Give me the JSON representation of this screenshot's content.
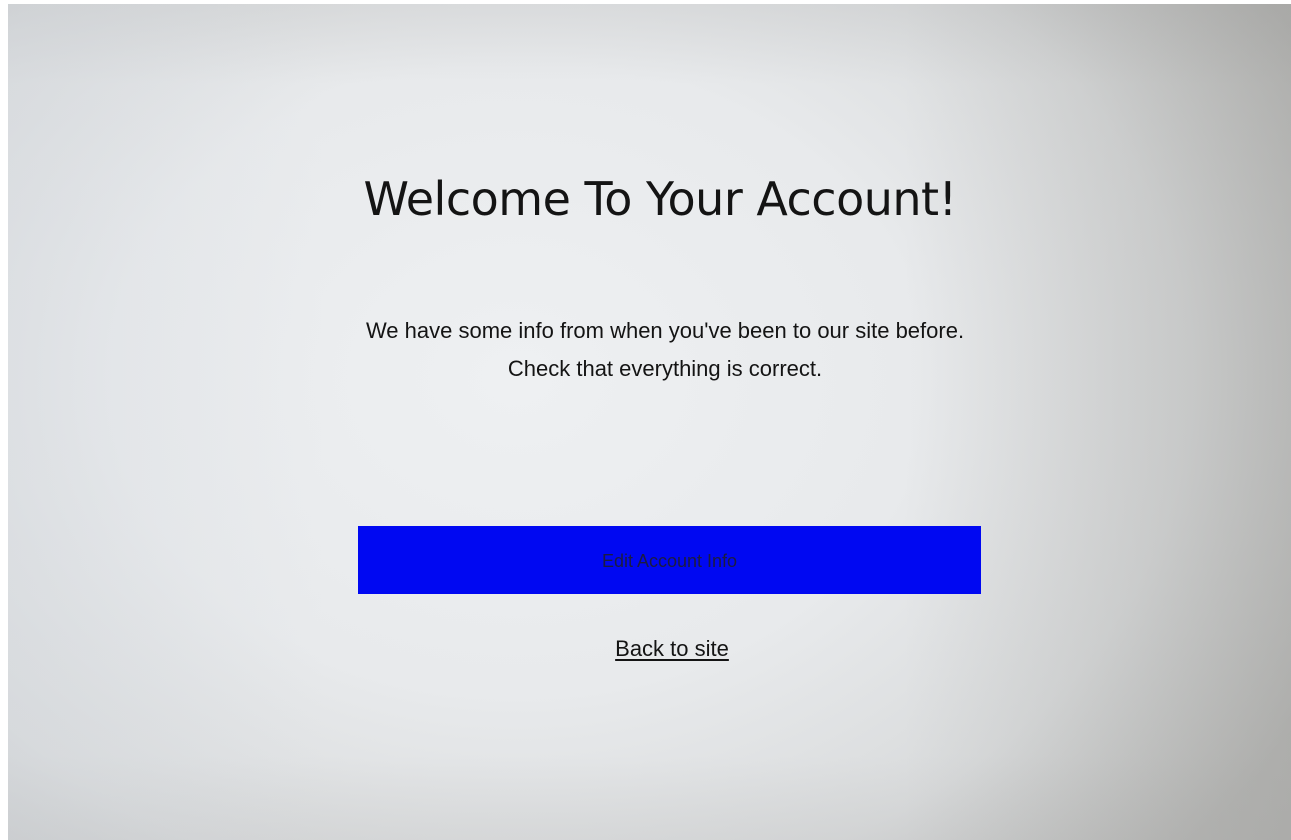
{
  "main": {
    "title": "Welcome To Your Account!",
    "intro_line1": "We have some info from when you've been to our site before.",
    "intro_line2": "Check that everything is correct.",
    "edit_button_label": "Edit Account Info",
    "back_link_label": "Back to site"
  },
  "colors": {
    "button_background": "#0008f2",
    "button_text": "#1c1c40",
    "text": "#141414",
    "page_background": "#e8eaec"
  }
}
